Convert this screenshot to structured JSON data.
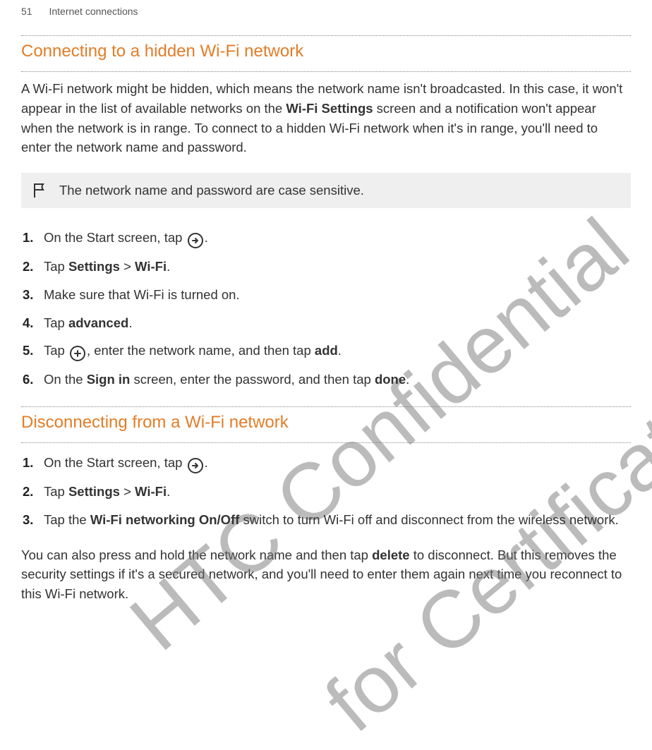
{
  "header": {
    "page_number": "51",
    "breadcrumb": "Internet connections"
  },
  "sections": {
    "connecting": {
      "title": "Connecting to a hidden Wi-Fi network",
      "intro_parts": {
        "p1": "A Wi-Fi network might be hidden, which means the network name isn't broadcasted. In this case, it won't appear in the list of available networks on the ",
        "b1": "Wi-Fi Settings",
        "p2": " screen and a notification won't appear when the network is in range. To connect to a hidden Wi-Fi network when it's in range, you'll need to enter the network name and password."
      },
      "callout": "The network name and password are case sensitive.",
      "steps": {
        "s1a": "On the Start screen, tap ",
        "s1b": ".",
        "s2a": "Tap ",
        "s2b1": "Settings",
        "s2mid": " > ",
        "s2b2": "Wi-Fi",
        "s2c": ".",
        "s3": "Make sure that Wi-Fi is turned on.",
        "s4a": "Tap ",
        "s4b": "advanced",
        "s4c": ".",
        "s5a": "Tap ",
        "s5mid": ", enter the network name, and then tap ",
        "s5b": "add",
        "s5c": ".",
        "s6a": "On the ",
        "s6b1": "Sign in",
        "s6mid": " screen, enter the password, and then tap ",
        "s6b2": "done",
        "s6c": "."
      }
    },
    "disconnecting": {
      "title": "Disconnecting from a Wi-Fi network",
      "steps": {
        "s1a": "On the Start screen, tap ",
        "s1b": ".",
        "s2a": "Tap ",
        "s2b1": "Settings",
        "s2mid": " > ",
        "s2b2": "Wi-Fi",
        "s2c": ".",
        "s3a": "Tap the ",
        "s3b": "Wi-Fi networking On/Off",
        "s3c": " switch to turn Wi-Fi off and disconnect from the wireless network."
      },
      "outro_parts": {
        "p1": "You can also press and hold the network name and then tap ",
        "b1": "delete",
        "p2": " to disconnect. But this removes the security settings if it's a secured network, and you'll need to enter them again next time you reconnect to this Wi-Fi network."
      }
    }
  },
  "watermarks": {
    "w1": "HTC Confidential",
    "w2": "for Certification only"
  }
}
